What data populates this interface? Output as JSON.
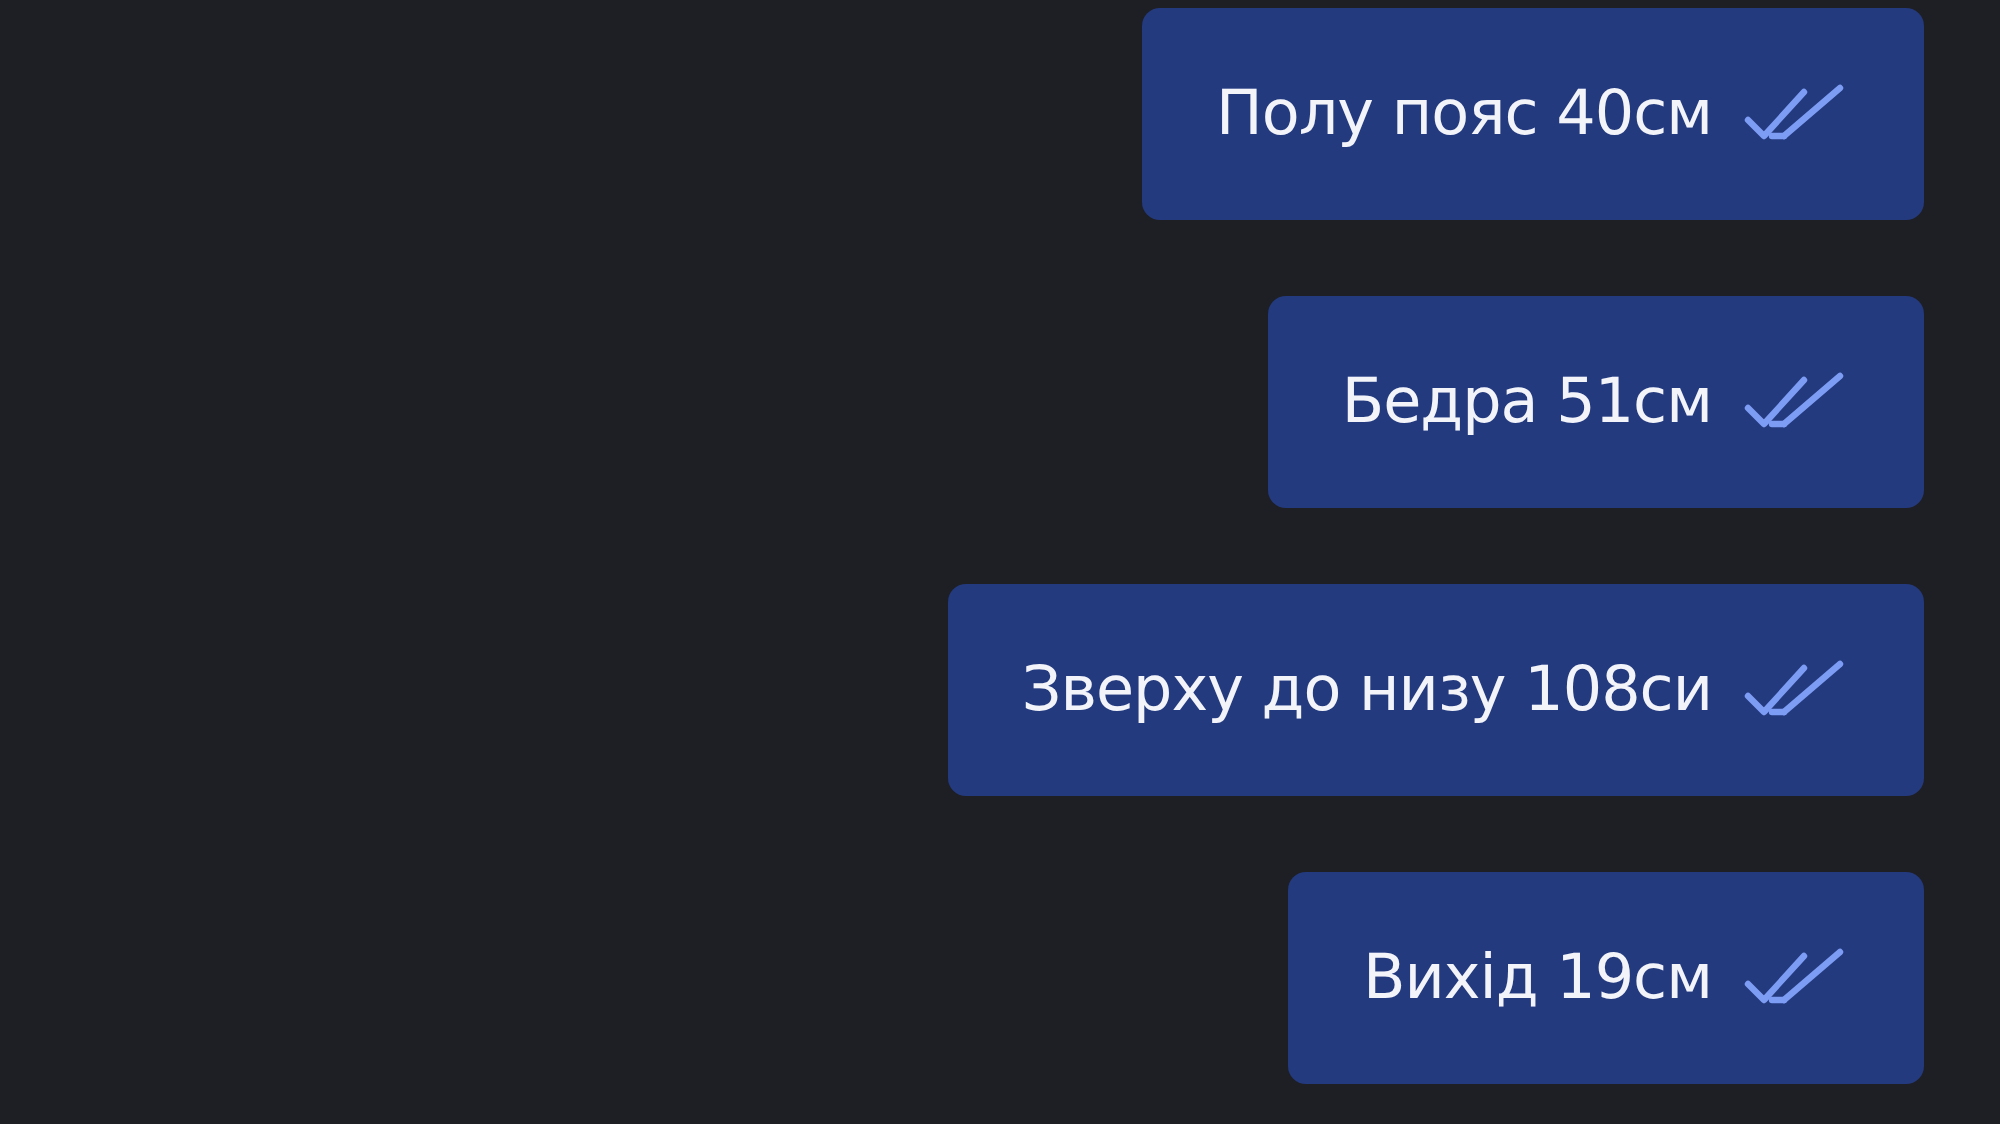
{
  "messages": [
    {
      "text": "Полу пояс 40см",
      "read": true
    },
    {
      "text": "Бедра 51см",
      "read": true
    },
    {
      "text": "Зверху до низу 108си",
      "read": true
    },
    {
      "text": "Вихід 19см",
      "read": true
    }
  ]
}
